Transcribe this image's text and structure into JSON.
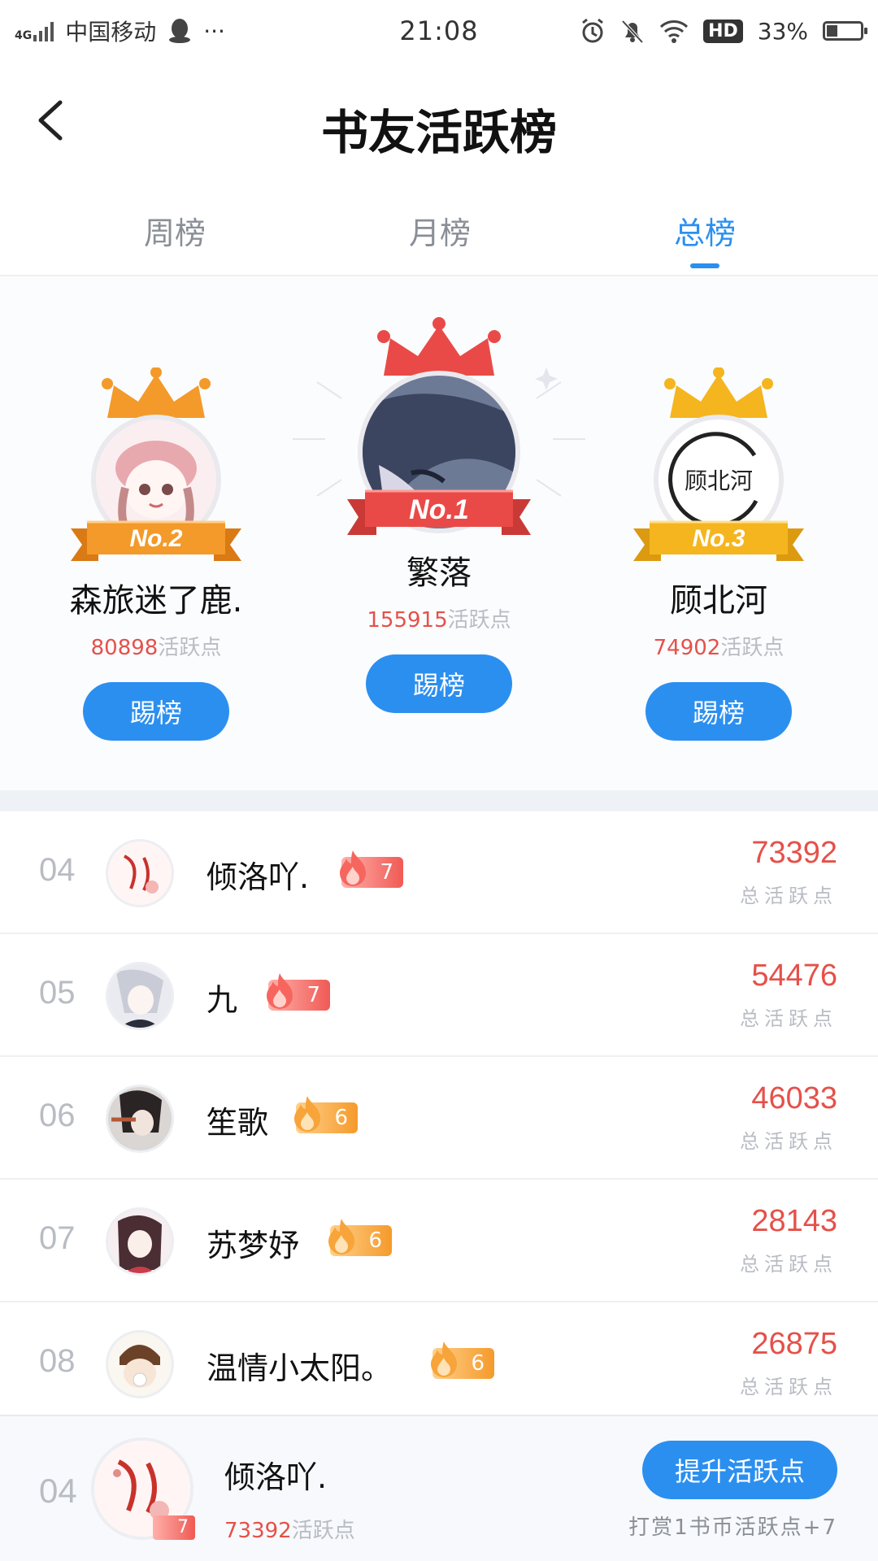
{
  "status_bar": {
    "network": "4G",
    "carrier": "中国移动",
    "more": "···",
    "time": "21:08",
    "hd": "HD",
    "battery_text": "33%",
    "battery_level": 0.33
  },
  "header": {
    "title": "书友活跃榜"
  },
  "tabs": [
    {
      "label": "周榜",
      "active": false
    },
    {
      "label": "月榜",
      "active": false
    },
    {
      "label": "总榜",
      "active": true
    }
  ],
  "podium": {
    "second": {
      "badge": "No.2",
      "name": "森旅迷了鹿.",
      "points": "80898",
      "unit": "活跃点",
      "button": "踢榜"
    },
    "first": {
      "badge": "No.1",
      "name": "繁落",
      "points": "155915",
      "unit": "活跃点",
      "button": "踢榜"
    },
    "third": {
      "badge": "No.3",
      "name": "顾北河",
      "points": "74902",
      "unit": "活跃点",
      "button": "踢榜",
      "avatar_text": "顾北河"
    }
  },
  "list": [
    {
      "rank": "04",
      "name": "倾洛吖.",
      "level": "7",
      "level_color": "red",
      "score": "73392",
      "score_label": "总活跃点"
    },
    {
      "rank": "05",
      "name": "九",
      "level": "7",
      "level_color": "red",
      "score": "54476",
      "score_label": "总活跃点"
    },
    {
      "rank": "06",
      "name": "笙歌",
      "level": "6",
      "level_color": "orange",
      "score": "46033",
      "score_label": "总活跃点"
    },
    {
      "rank": "07",
      "name": "苏梦妤",
      "level": "6",
      "level_color": "orange",
      "score": "28143",
      "score_label": "总活跃点"
    },
    {
      "rank": "08",
      "name": "温情小太阳。",
      "level": "6",
      "level_color": "orange",
      "score": "26875",
      "score_label": "总活跃点"
    }
  ],
  "me": {
    "rank": "04",
    "name": "倾洛吖.",
    "level": "7",
    "points": "73392",
    "unit": "活跃点",
    "button": "提升活跃点",
    "hint": "打赏1书币活跃点+7"
  },
  "colors": {
    "accent": "#2b8ff0",
    "score_red": "#e6504a",
    "gold": "#f5b51f",
    "silver_orange": "#f39a2a",
    "first_red": "#ea4a47"
  }
}
